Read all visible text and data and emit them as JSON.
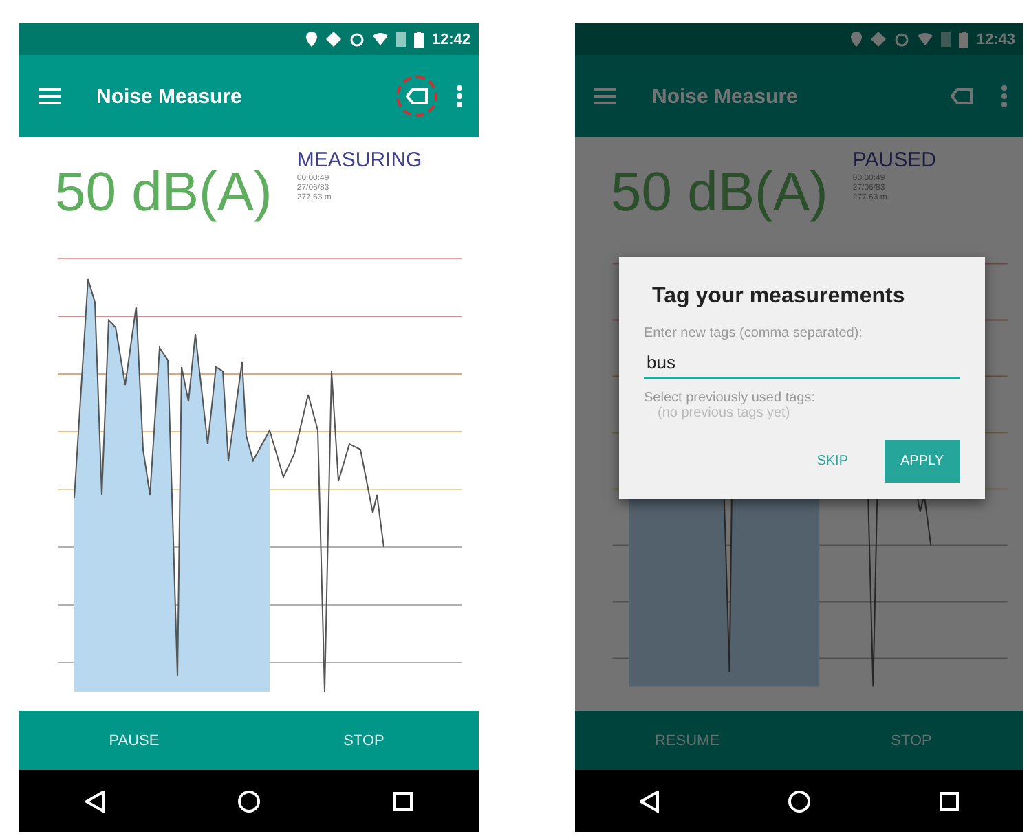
{
  "screens": [
    {
      "status_time": "12:42",
      "title": "Noise Measure",
      "tag_highlighted": true,
      "reading": "50 dB(A)",
      "state": "MEASURING",
      "details": [
        "00:00:49",
        "27/06/83",
        "277.63 m"
      ],
      "buttons": [
        "PAUSE",
        "STOP"
      ]
    },
    {
      "status_time": "12:43",
      "title": "Noise Measure",
      "tag_highlighted": false,
      "reading": "50 dB(A)",
      "state": "PAUSED",
      "details": [
        "00:00:49",
        "27/06/83",
        "277.63 m"
      ],
      "buttons": [
        "RESUME",
        "STOP"
      ],
      "dialog": {
        "title": "Tag your measurements",
        "prompt": "Enter new tags (comma separated):",
        "value": "bus",
        "section": "Select previously used tags:",
        "empty": "(no previous tags yet)",
        "actions": [
          {
            "label": "SKIP",
            "kind": "flat"
          },
          {
            "label": "APPLY",
            "kind": "raised"
          }
        ]
      }
    }
  ]
}
